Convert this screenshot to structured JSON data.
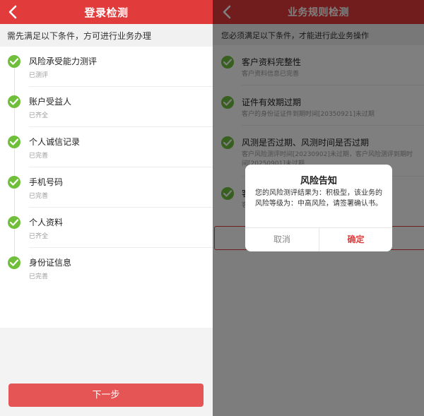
{
  "left": {
    "nav": {
      "title": "登录检测"
    },
    "notice": "需先满足以下条件，方可进行业务办理",
    "items": [
      {
        "name": "风险承受能力测评",
        "status": "已测评"
      },
      {
        "name": "账户受益人",
        "status": "已齐全"
      },
      {
        "name": "个人诚信记录",
        "status": "已完善"
      },
      {
        "name": "手机号码",
        "status": "已完善"
      },
      {
        "name": "个人资料",
        "status": "已齐全"
      },
      {
        "name": "身份证信息",
        "status": "已完善"
      }
    ],
    "next_button": "下一步"
  },
  "right": {
    "nav": {
      "title": "业务规则检测"
    },
    "notice": "您必须满足以下条件，才能进行此业务操作",
    "items": [
      {
        "name": "客户资料完整性",
        "status": "客户资料信息已完善"
      },
      {
        "name": "证件有效期过期",
        "status": "客户的身份证证件到期时间[20350921]未过期"
      },
      {
        "name": "风测是否过期、风测时间是否过期",
        "status": "客户风险测评时间[20230902]未过期，客户风险测评到期时间[20250901]未过期"
      },
      {
        "name": "客户",
        "status": "客户"
      }
    ],
    "dialog": {
      "title": "风险告知",
      "body": "您的风险测评结果为：积极型，该业务的风险等级为：中高风险，请签署确认书。",
      "cancel": "取消",
      "confirm": "确定"
    }
  },
  "colors": {
    "brand_red": "#e23b3b",
    "check_green": "#6fbf3a",
    "button_red": "#e65556"
  }
}
